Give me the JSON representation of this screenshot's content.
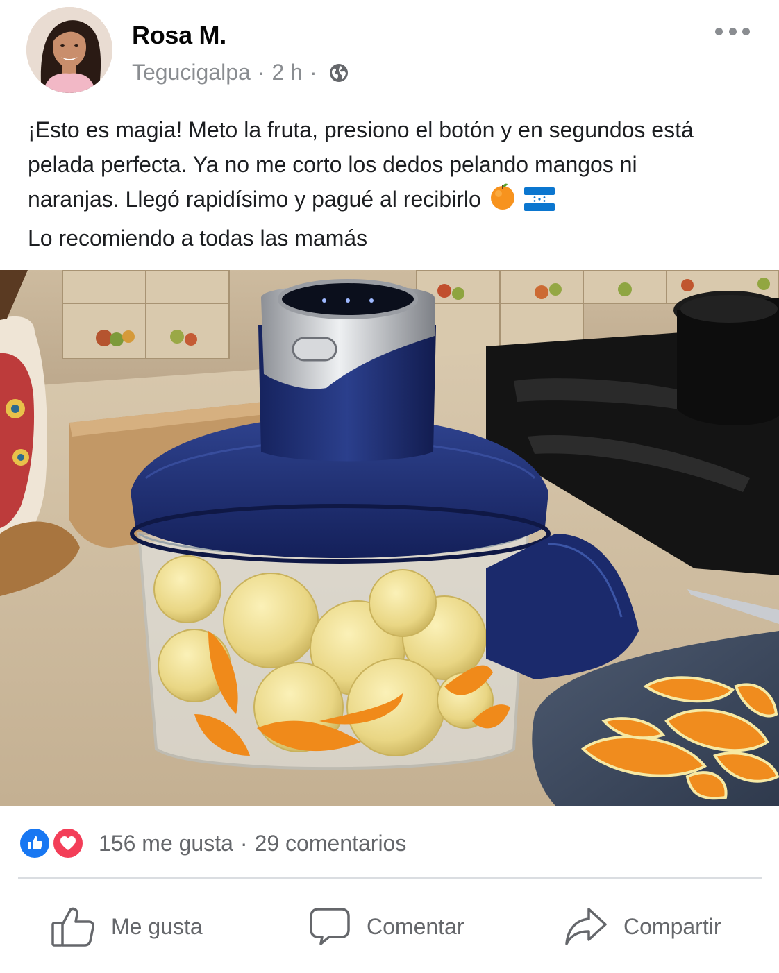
{
  "post": {
    "author": "Rosa M.",
    "location": "Tegucigalpa",
    "time": "2 h",
    "separator": "·",
    "privacy_icon": "globe-icon",
    "more_icon": "more-horizontal-icon",
    "text": {
      "line1": "¡Esto es magia! Meto la fruta, presiono el botón y en segundos está",
      "line2": "pelada perfecta. Ya no me corto los dedos pelando mangos ni",
      "line3": "naranjas. Llegó rapidísimo y pagué al recibirlo",
      "emoji_1": "🍊",
      "emoji_2": "🇭🇳",
      "line4": "Lo recomiendo a todas las mamás"
    },
    "photo_icon": "fruit-peeler-photo"
  },
  "reactions": {
    "likes": "156 me gusta",
    "separator": "·",
    "comments": "29 comentarios",
    "icons": [
      "like-icon",
      "love-icon"
    ],
    "like_color": "#1877f2",
    "love_color": "#f33e58"
  },
  "actions": {
    "like": {
      "label": "Me gusta",
      "icon": "thumbs-up-icon"
    },
    "comment": {
      "label": "Comentar",
      "icon": "comment-icon"
    },
    "share": {
      "label": "Compartir",
      "icon": "share-icon"
    }
  },
  "colors": {
    "secondary_text": "#65676b",
    "meta_text": "#8a8d91",
    "appliance_blue": "#1d2b6b"
  }
}
